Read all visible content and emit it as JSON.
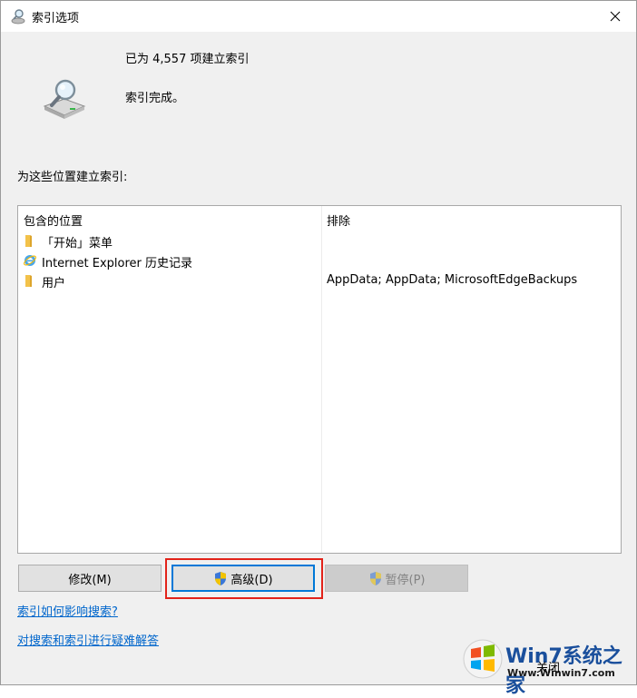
{
  "window": {
    "title": "索引选项"
  },
  "status": {
    "indexed_count_text": "已为 4,557 项建立索引",
    "state_text": "索引完成。"
  },
  "locations": {
    "label": "为这些位置建立索引:",
    "columns": {
      "included": "包含的位置",
      "excluded": "排除"
    },
    "rows": [
      {
        "name": "「开始」菜单",
        "exclude": "",
        "icon": "folder-icon"
      },
      {
        "name": "Internet Explorer 历史记录",
        "exclude": "",
        "icon": "internet-explorer-icon"
      },
      {
        "name": "用户",
        "exclude": "AppData; AppData; MicrosoftEdgeBackups",
        "icon": "folder-icon"
      }
    ]
  },
  "buttons": {
    "modify": "修改(M)",
    "advanced": "高级(D)",
    "pause": "暂停(P)",
    "close": "关闭"
  },
  "links": {
    "how_indexing_affects": "索引如何影响搜索?",
    "troubleshoot": "对搜索和索引进行疑难解答"
  },
  "watermark": {
    "title": "Win7系统之家",
    "url": "Www.Winwin7.com"
  },
  "colors": {
    "link": "#0066cc",
    "highlight": "#e2231a",
    "primary_border": "#0078d7"
  }
}
